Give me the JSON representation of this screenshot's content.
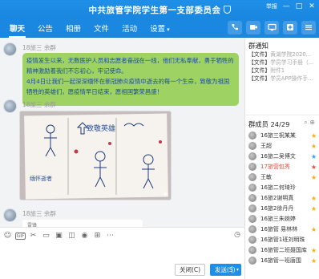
{
  "window": {
    "title": "中共旅管学院学生第一支部委员会",
    "controls": [
      "举报",
      "—",
      "□",
      "✕"
    ]
  },
  "tabs": [
    {
      "label": "聊天",
      "active": true
    },
    {
      "label": "公告",
      "active": false
    },
    {
      "label": "相册",
      "active": false
    },
    {
      "label": "文件",
      "active": false
    },
    {
      "label": "活动",
      "active": false
    },
    {
      "label": "设置",
      "active": false,
      "caret": "▾"
    }
  ],
  "toolbar_icons": [
    "phone-icon",
    "video-icon",
    "share-screen-icon",
    "add-app-icon",
    "more-icon"
  ],
  "messages": [
    {
      "sender_role": "",
      "sender_name": "18旅三 余群",
      "paragraphs": [
        "疫情发生以来，无数医护人员和志愿者奋战在一线，他们无私奉献，勇于牺牲的精神激励着我们不忘初心，牢记使命。",
        "4月4日让我们一起深深缅怀在新冠肺炎疫情中逝去的每一个生命，致敬为祖国牺牲的英雄们，愿疫情早日结束，愿祖国繁荣昌盛！"
      ]
    },
    {
      "sender_role": "",
      "sender_name": "18旅三 余群",
      "type": "image",
      "image_caption": "致敬英雄",
      "image_caption2": "缅怀逝者"
    },
    {
      "sender_role": "",
      "sender_name": "18旅三 余群",
      "preview_name": "雷锋",
      "preview_text": "..."
    }
  ],
  "input": {
    "tools": [
      "smile-icon",
      "gif-icon",
      "scissors-icon",
      "folder-icon",
      "image-icon",
      "shake-icon",
      "mic-icon",
      "apps-icon",
      "more-icon"
    ],
    "gif_label": "GIF",
    "history_label": "◷",
    "close_label": "关闭(C)",
    "send_label": "发送(S)",
    "send_dropdown": "▾"
  },
  "sidebar": {
    "notice_title": "群通知",
    "notices": [
      {
        "tag": "【文件】",
        "text": "黄湖学院2020..."
      },
      {
        "tag": "【文件】",
        "text": "学员学习手册（..."
      },
      {
        "tag": "【文件】",
        "text": "附件1"
      },
      {
        "tag": "【文件】",
        "text": "学员APP操作手..."
      }
    ],
    "members_title": "群成员 24/29",
    "members_icons": "⌕ ⊕",
    "members": [
      {
        "name": "16旅三祝某某",
        "badge": "★",
        "badge_color": "gold",
        "highlight": false
      },
      {
        "name": "王超",
        "badge": "★",
        "badge_color": "gold",
        "highlight": false
      },
      {
        "name": "16旅二吴博文",
        "badge": "★",
        "badge_color": "blue",
        "highlight": false
      },
      {
        "name": "17旅营包秀",
        "badge": "★",
        "badge_color": "red",
        "highlight": true
      },
      {
        "name": "王敏",
        "badge": "★",
        "badge_color": "gold",
        "highlight": false
      },
      {
        "name": "16旅二何琦玲",
        "badge": "",
        "badge_color": "",
        "highlight": false
      },
      {
        "name": "16旅2谢明真",
        "badge": "★",
        "badge_color": "gold",
        "highlight": false
      },
      {
        "name": "16旅2徐丹丹",
        "badge": "★",
        "badge_color": "gold",
        "highlight": false
      },
      {
        "name": "16旅三朱婉婷",
        "badge": "",
        "badge_color": "",
        "highlight": false
      },
      {
        "name": "16旅管 易林林",
        "badge": "★",
        "badge_color": "gold",
        "highlight": false
      },
      {
        "name": "16旅管1班刘明珠",
        "badge": "",
        "badge_color": "",
        "highlight": false
      },
      {
        "name": "16旅管二班聂国库",
        "badge": "★",
        "badge_color": "gold",
        "highlight": false
      },
      {
        "name": "16旅管一班唐围",
        "badge": "★",
        "badge_color": "gold",
        "highlight": false
      }
    ]
  }
}
